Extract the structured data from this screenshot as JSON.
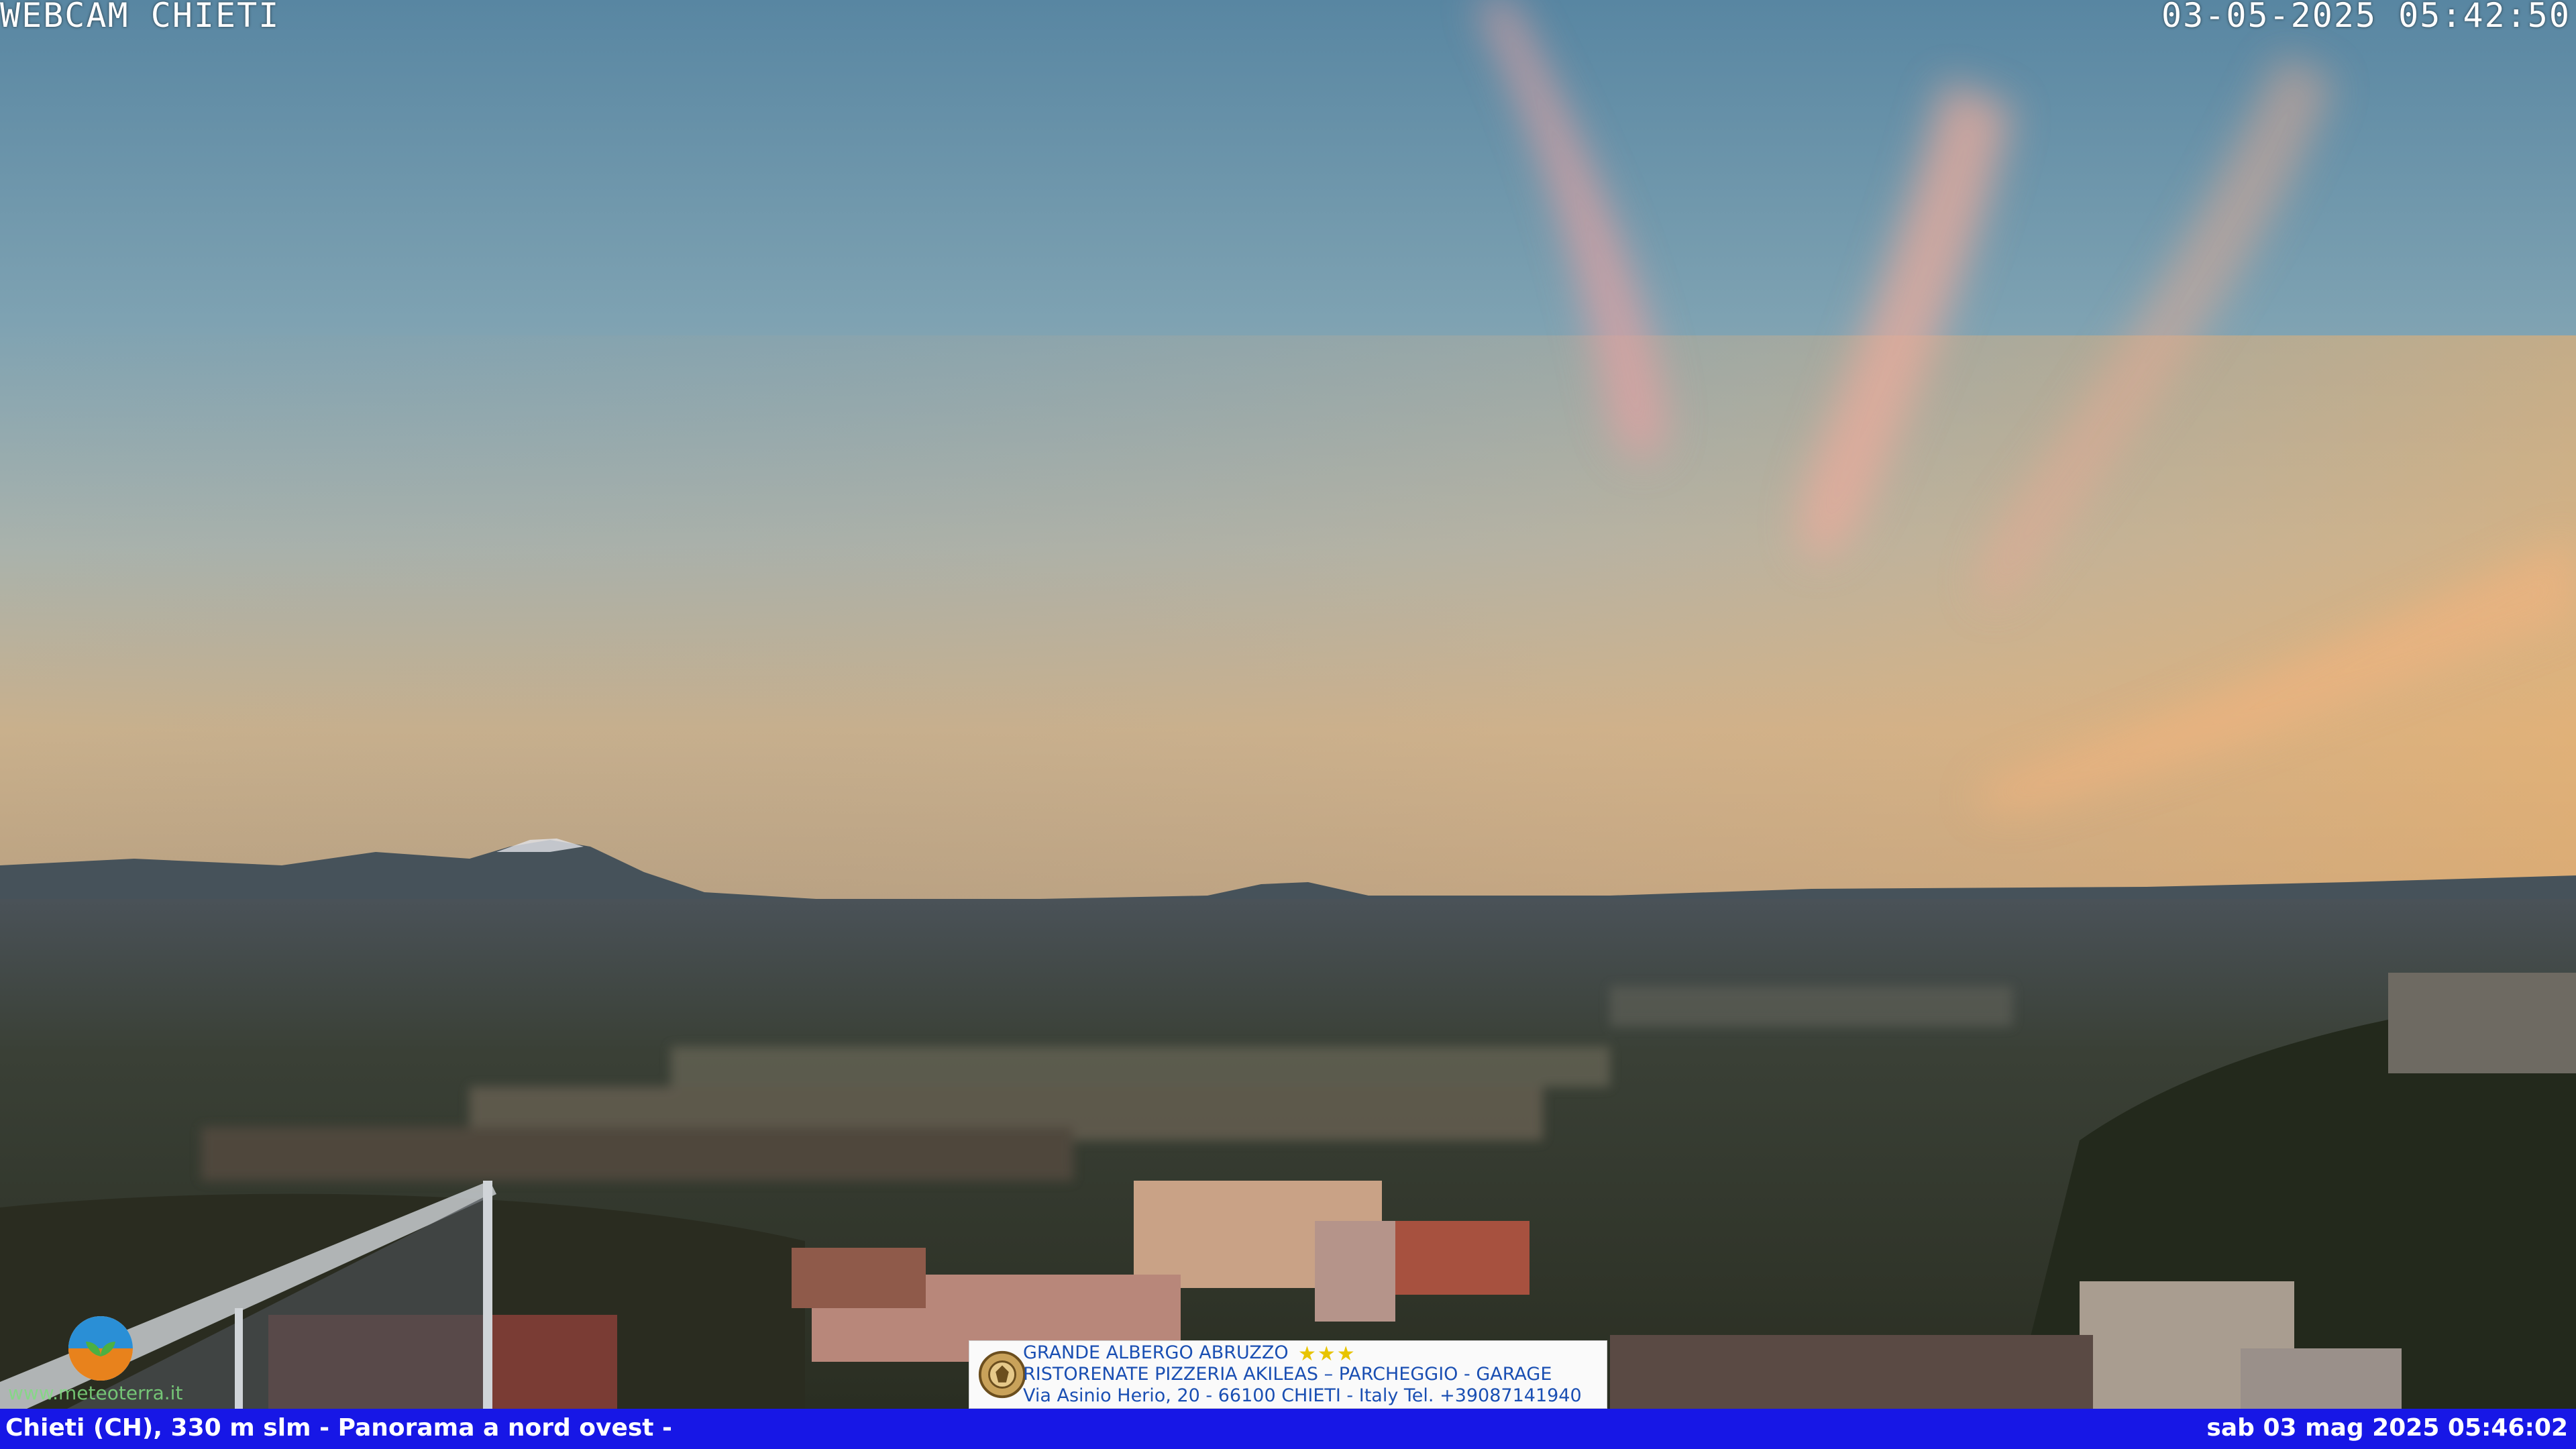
{
  "camera": {
    "title": "WEBCAM CHIETI",
    "timestamp": "03-05-2025 05:42:50"
  },
  "footer": {
    "location": "Chieti (CH), 330 m slm - Panorama a nord ovest -",
    "datetime": "sab 03 mag 2025 05:46:02",
    "bar_color": "#1717e6"
  },
  "advertisement": {
    "line1": "GRANDE ALBERGO ABRUZZO",
    "stars": "★★★",
    "line2": "RISTORENATE PIZZERIA AKILEAS – PARCHEGGIO - GARAGE",
    "line3": "Via Asinio Herio, 20 - 66100 CHIETI - Italy Tel. +39087141940"
  },
  "watermark": {
    "url": "www.meteoterra.it"
  },
  "scene": {
    "sky_top": "#5a8aa6",
    "sky_mid": "#92adb4",
    "sky_horizon": "#d4b48a",
    "cloud_tint": "#e6a69c",
    "mountains": "#3e4a52",
    "city_tint": "#3b3f35"
  }
}
